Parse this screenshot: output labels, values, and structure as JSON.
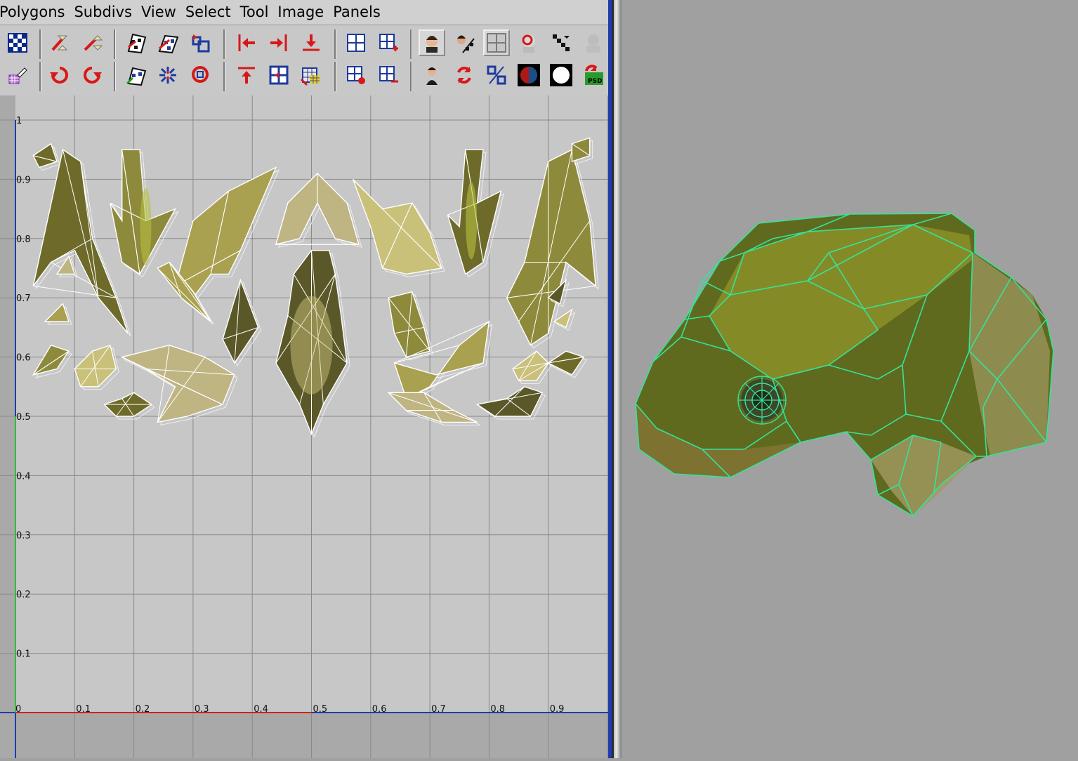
{
  "menu": {
    "items": [
      "Polygons",
      "Subdivs",
      "View",
      "Select",
      "Tool",
      "Image",
      "Panels"
    ]
  },
  "toolbar": {
    "row1": [
      "checker-tile-icon",
      "flip-u-icon",
      "flip-v-icon",
      "snapshot-checker-icon",
      "snapshot-checker2-icon",
      "cycle-uvs-icon",
      "align-left-icon",
      "align-right-icon",
      "align-bottom-icon",
      "grid-layout-icon",
      "grid-add-icon",
      "view-face-icon",
      "view-face-uv-icon",
      "grid-toggle-icon",
      "isolate-head-icon",
      "checker-small-icon",
      "ghost-head-icon"
    ],
    "row2": [
      "uv-pick-icon",
      "rotate-ccw-icon",
      "rotate-cw-icon",
      "unfold-icon",
      "relax-icon",
      "layout-loop-icon",
      "align-top-icon",
      "center-grid-icon",
      "texture-grid-icon",
      "grid-remove-icon",
      "grid-minus-icon",
      "portrait-icon",
      "refresh-icon",
      "percent-icon",
      "shaded-sphere-icon",
      "white-sphere-icon",
      "psd-icon"
    ]
  },
  "uv_editor": {
    "x_ticks": [
      "0",
      "0.1",
      "0.2",
      "0.3",
      "0.4",
      "0.5",
      "0.6",
      "0.7",
      "0.8",
      "0.9"
    ],
    "y_ticks": [
      "0.1",
      "0.2",
      "0.3",
      "0.4",
      "0.5",
      "0.6",
      "0.7",
      "0.8",
      "0.9",
      "1"
    ],
    "grid_color": "#8a8a8a",
    "u_axis_color": "#d42020",
    "v_axis_color": "#30c030",
    "frame_color": "#1f3bb0",
    "texture_colors": [
      "#6e6b2a",
      "#8e8a3c",
      "#a9a050",
      "#bfb583",
      "#5a5828",
      "#c9c07a"
    ]
  },
  "viewport": {
    "object": "frog model",
    "wire_color": "#34e39a",
    "body_colors": [
      "#5f6a1e",
      "#8d9428",
      "#a39a62",
      "#7d7230"
    ]
  }
}
